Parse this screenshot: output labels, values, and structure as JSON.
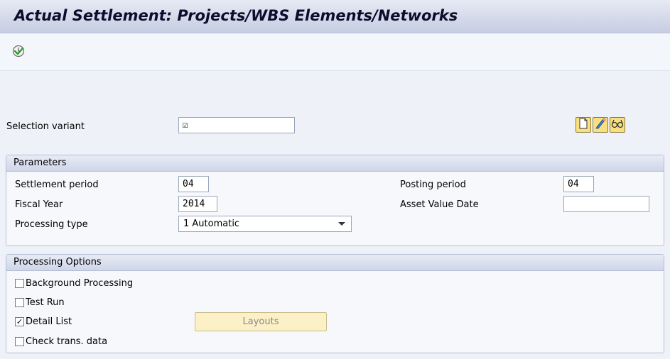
{
  "header": {
    "title": "Actual Settlement: Projects/WBS Elements/Networks"
  },
  "toolbar": {
    "execute_icon": "execute-clock-icon"
  },
  "selection_variant": {
    "label": "Selection variant",
    "value": "☑",
    "buttons": [
      {
        "icon": "create-document-icon"
      },
      {
        "icon": "edit-pencil-icon"
      },
      {
        "icon": "display-glasses-icon"
      }
    ]
  },
  "parameters": {
    "title": "Parameters",
    "settlement_period": {
      "label": "Settlement period",
      "value": "04"
    },
    "fiscal_year": {
      "label": "Fiscal Year",
      "value": "2014"
    },
    "processing_type": {
      "label": "Processing type",
      "value": "1 Automatic"
    },
    "posting_period": {
      "label": "Posting period",
      "value": "04"
    },
    "asset_value_date": {
      "label": "Asset Value Date",
      "value": ""
    }
  },
  "processing_options": {
    "title": "Processing Options",
    "background_processing": {
      "label": "Background Processing",
      "checked": false
    },
    "test_run": {
      "label": "Test Run",
      "checked": false
    },
    "detail_list": {
      "label": "Detail List",
      "checked": true,
      "mark": "✓"
    },
    "check_trans_data": {
      "label": "Check trans. data",
      "checked": false
    },
    "layouts_button": "Layouts"
  },
  "colors": {
    "background": "#eef2f8",
    "title_bar": "#c6cde2",
    "button_yellow": "#f9df7d",
    "group_header": "#cfd6e8"
  }
}
